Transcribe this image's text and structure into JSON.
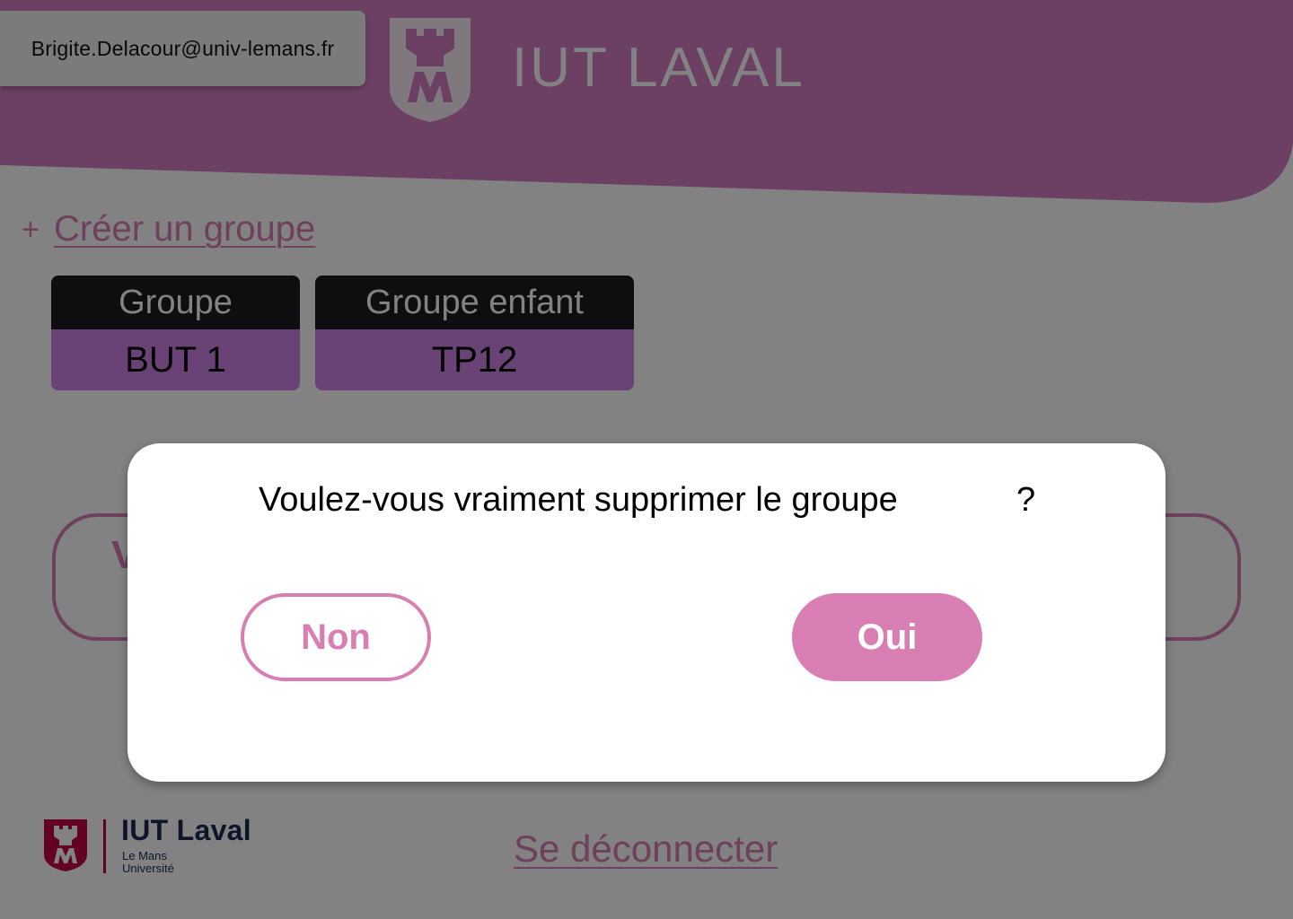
{
  "header": {
    "user_email": "Brigite.Delacour@univ-lemans.fr",
    "title": "IUT LAVAL",
    "logo_icon": "iut-shield-logo-icon"
  },
  "actions": {
    "create_plus": "+",
    "create_group_label": "Créer un groupe"
  },
  "groups": [
    {
      "header": "Groupe",
      "value": "BUT 1"
    },
    {
      "header": "Groupe enfant",
      "value": "TP12"
    }
  ],
  "background_button": {
    "partial_label": "V"
  },
  "modal": {
    "question": "Voulez-vous vraiment supprimer le groupe",
    "question_mark": "?",
    "no_label": "Non",
    "yes_label": "Oui"
  },
  "footer": {
    "brand": "IUT Laval",
    "sub_line1": "Le Mans",
    "sub_line2": "Université",
    "logout_label": "Se déconnecter"
  },
  "colors": {
    "header": "#d57fc0",
    "accent": "#d87eb3",
    "card_body": "#cf84e8",
    "card_head": "#1c1b1f",
    "footer_brand": "#1b2a55",
    "footer_logo": "#c7004a",
    "overlay": "rgba(0,0,0,0.49)"
  }
}
